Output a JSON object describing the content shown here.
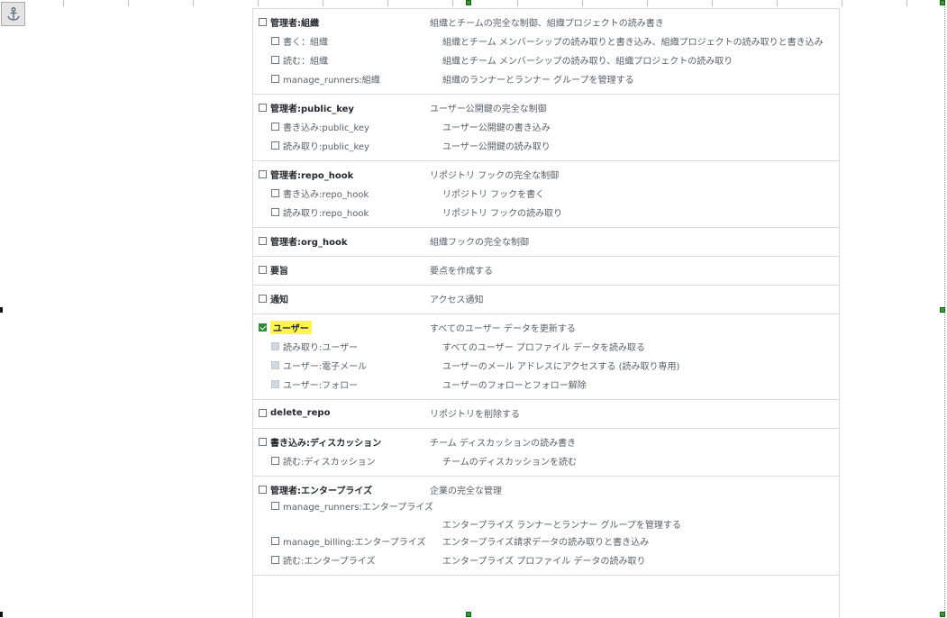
{
  "scopes": [
    {
      "parent": {
        "label": "管理者:組織",
        "desc": "組織とチームの完全な制御、組織プロジェクトの読み書き",
        "checked": false
      },
      "children": [
        {
          "label": "書く：組織",
          "desc": "組織とチーム メンバーシップの読み取りと書き込み、組織プロジェクトの読み取りと書き込み"
        },
        {
          "label": "読む：組織",
          "desc": "組織とチーム メンバーシップの読み取り、組織プロジェクトの読み取り"
        },
        {
          "label": "manage_runners:組織",
          "desc": "組織のランナーとランナー グループを管理する"
        }
      ]
    },
    {
      "parent": {
        "label": "管理者:public_key",
        "desc": "ユーザー公開鍵の完全な制御",
        "checked": false
      },
      "children": [
        {
          "label": "書き込み:public_key",
          "desc": "ユーザー公開鍵の書き込み"
        },
        {
          "label": "読み取り:public_key",
          "desc": "ユーザー公開鍵の読み取り"
        }
      ]
    },
    {
      "parent": {
        "label": "管理者:repo_hook",
        "desc": "リポジトリ フックの完全な制御",
        "checked": false
      },
      "children": [
        {
          "label": "書き込み:repo_hook",
          "desc": "リポジトリ フックを書く"
        },
        {
          "label": "読み取り:repo_hook",
          "desc": "リポジトリ フックの読み取り"
        }
      ]
    },
    {
      "parent": {
        "label": "管理者:org_hook",
        "desc": "組織フックの完全な制御",
        "checked": false
      },
      "children": []
    },
    {
      "parent": {
        "label": "要旨",
        "desc": "要点を作成する",
        "checked": false
      },
      "children": []
    },
    {
      "parent": {
        "label": "通知",
        "desc": "アクセス通知",
        "checked": false
      },
      "children": []
    },
    {
      "parent": {
        "label": "ユーザー",
        "desc": "すべてのユーザー データを更新する",
        "checked": true,
        "highlight": true
      },
      "children": [
        {
          "label": "読み取り:ユーザー",
          "desc": "すべてのユーザー プロファイル データを読み取る",
          "disabled": true
        },
        {
          "label": "ユーザー:電子メール",
          "desc": "ユーザーのメール アドレスにアクセスする (読み取り専用)",
          "disabled": true
        },
        {
          "label": "ユーザー:フォロー",
          "desc": "ユーザーのフォローとフォロー解除",
          "disabled": true
        }
      ]
    },
    {
      "parent": {
        "label": "delete_repo",
        "desc": "リポジトリを削除する",
        "checked": false
      },
      "children": []
    },
    {
      "parent": {
        "label": "書き込み:ディスカッション",
        "desc": "チーム ディスカッションの読み書き",
        "checked": false
      },
      "children": [
        {
          "label": "読む:ディスカッション",
          "desc": "チームのディスカッションを読む"
        }
      ]
    },
    {
      "parent": {
        "label": "管理者:エンタープライズ",
        "desc": "企業の完全な管理",
        "checked": false
      },
      "children": [
        {
          "label": "manage_runners:エンタープライズ",
          "desc": "エンタープライズ ランナーとランナー グループを管理する",
          "tall": true
        },
        {
          "label": "manage_billing:エンタープライズ",
          "desc": "エンタープライズ請求データの読み取りと書き込み"
        },
        {
          "label": "読む:エンタープライズ",
          "desc": "エンタープライズ プロファイル データの読み取り"
        }
      ]
    }
  ],
  "colors": {
    "checked": "#2e8b37",
    "highlight": "#fff34f",
    "handle": "#2e9e2e"
  },
  "icons": {
    "anchor": "anchor-icon"
  }
}
